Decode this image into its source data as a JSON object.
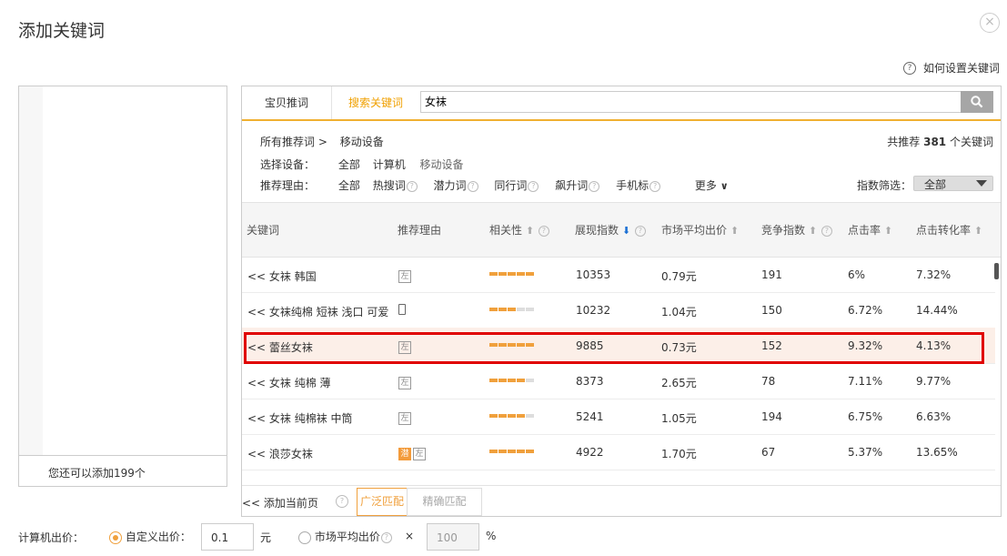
{
  "dialog": {
    "title": "添加关键词",
    "close": "×",
    "help_text": "如何设置关键词",
    "help_q": "?"
  },
  "left_panel": {
    "footer": "您还可以添加199个"
  },
  "tabs": [
    {
      "label": "宝贝推词"
    },
    {
      "label": "搜索关键词"
    }
  ],
  "search": {
    "value": "女袜"
  },
  "breadcrumb": {
    "root": "所有推荐词 >",
    "current": "移动设备"
  },
  "total": {
    "prefix": "共推荐",
    "count": "381",
    "suffix": "个关键词"
  },
  "device": {
    "label": "选择设备：",
    "options": [
      "全部",
      "计算机",
      "移动设备"
    ]
  },
  "reason": {
    "label": "推荐理由：",
    "options": [
      "全部",
      "热搜词",
      "潜力词",
      "同行词",
      "飙升词",
      "手机标"
    ],
    "more": "更多"
  },
  "index_filter": {
    "label": "指数筛选：",
    "value": "全部"
  },
  "columns": [
    "关键词",
    "推荐理由",
    "相关性",
    "展现指数",
    "市场平均出价",
    "竞争指数",
    "点击率",
    "点击转化率"
  ],
  "rows": [
    {
      "keyword": "<< 女袜 韩国",
      "reason": "左",
      "relevance": 5,
      "impressions": "10353",
      "avg_bid": "0.79元",
      "competition": "191",
      "ctr": "6%",
      "cvr": "7.32%"
    },
    {
      "keyword": "<< 女袜纯棉 短袜 浅口 可爱",
      "reason": "phone",
      "relevance": 3,
      "impressions": "10232",
      "avg_bid": "1.04元",
      "competition": "150",
      "ctr": "6.72%",
      "cvr": "14.44%"
    },
    {
      "keyword": "<< 蕾丝女袜",
      "reason": "左",
      "relevance": 5,
      "impressions": "9885",
      "avg_bid": "0.73元",
      "competition": "152",
      "ctr": "9.32%",
      "cvr": "4.13%"
    },
    {
      "keyword": "<< 女袜 纯棉 薄",
      "reason": "左",
      "relevance": 4,
      "impressions": "8373",
      "avg_bid": "2.65元",
      "competition": "78",
      "ctr": "7.11%",
      "cvr": "9.77%"
    },
    {
      "keyword": "<< 女袜 纯棉袜 中筒",
      "reason": "左",
      "relevance": 4,
      "impressions": "5241",
      "avg_bid": "1.05元",
      "competition": "194",
      "ctr": "6.75%",
      "cvr": "6.63%"
    },
    {
      "keyword": "<< 浪莎女袜",
      "reason": "潜 左",
      "relevance": 5,
      "impressions": "4922",
      "avg_bid": "1.70元",
      "competition": "67",
      "ctr": "5.37%",
      "cvr": "13.65%"
    }
  ],
  "footer": {
    "add_page": "<< 添加当前页",
    "broad_match": "广泛匹配",
    "exact_match": "精确匹配"
  },
  "bid": {
    "label": "计算机出价：",
    "custom_label": "自定义出价：",
    "custom_value": "0.1",
    "unit": "元",
    "market_label": "市场平均出价",
    "times": "×",
    "market_value": "100",
    "percent": "%"
  },
  "colors": {
    "accent": "#f0a03c",
    "highlight": "#e00000",
    "sort_arrow": "#1a6fd4"
  }
}
